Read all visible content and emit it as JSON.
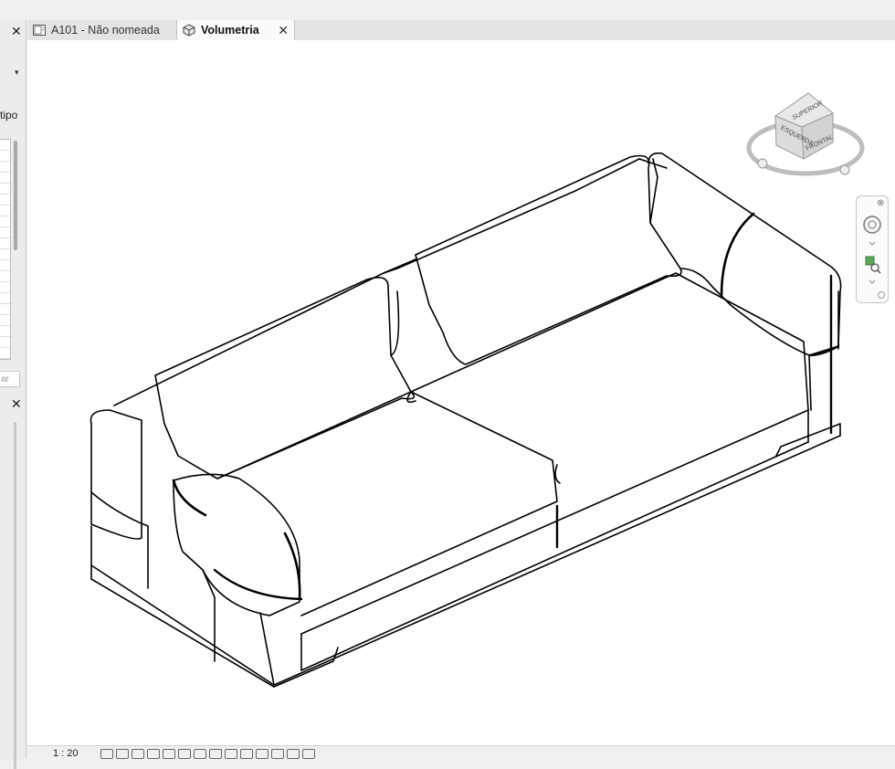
{
  "left_panel": {
    "close_glyph": "✕",
    "dropdown_glyph": "▾",
    "type_label_fragment": "tipo",
    "search_placeholder_fragment": "ar"
  },
  "tabs": [
    {
      "label": "A101 - Não nomeada",
      "icon": "sheet-icon",
      "active": false
    },
    {
      "label": "Volumetria",
      "icon": "3d-view-icon",
      "active": true,
      "close_glyph": "✕"
    }
  ],
  "viewcube": {
    "top_face": "SUPERIOR",
    "front_face": "FRONTAL",
    "left_face": "ESQUERDA"
  },
  "status_bar": {
    "scale": "1 : 20"
  },
  "colors": {
    "canvas": "#ffffff",
    "chrome": "#f0f0f0",
    "line": "#000000"
  }
}
